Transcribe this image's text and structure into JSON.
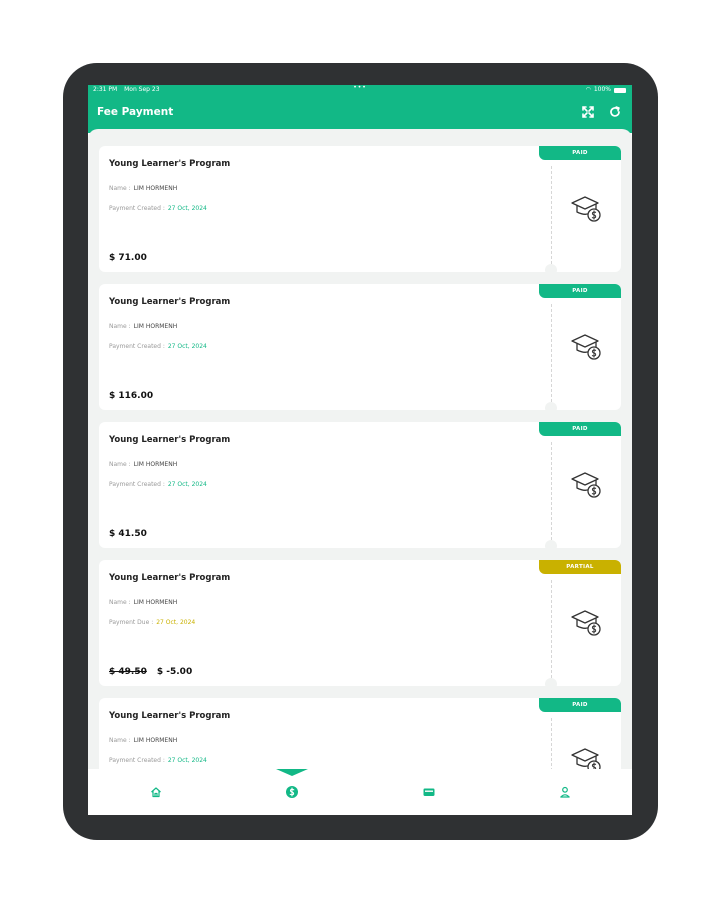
{
  "status_bar": {
    "time": "2:31 PM",
    "date": "Mon Sep 23",
    "dots": "•••",
    "battery": "100%"
  },
  "header": {
    "title": "Fee Payment"
  },
  "cards": [
    {
      "title": "Young Learner's Program",
      "name_label": "Name :",
      "name_value": "LIM HORMENH",
      "date_label": "Payment Created :",
      "date_value": "27 Oct, 2024",
      "amount": "$ 71.00",
      "original_amount": "",
      "status": "PAID"
    },
    {
      "title": "Young Learner's Program",
      "name_label": "Name :",
      "name_value": "LIM HORMENH",
      "date_label": "Payment Created :",
      "date_value": "27 Oct, 2024",
      "amount": "$ 116.00",
      "original_amount": "",
      "status": "PAID"
    },
    {
      "title": "Young Learner's Program",
      "name_label": "Name :",
      "name_value": "LIM HORMENH",
      "date_label": "Payment Created :",
      "date_value": "27 Oct, 2024",
      "amount": "$ 41.50",
      "original_amount": "",
      "status": "PAID"
    },
    {
      "title": "Young Learner's Program",
      "name_label": "Name :",
      "name_value": "LIM HORMENH",
      "date_label": "Payment Due :",
      "date_value": "27 Oct, 2024",
      "amount": "$ -5.00",
      "original_amount": "$ 49.50",
      "status": "PARTIAL"
    },
    {
      "title": "Young Learner's Program",
      "name_label": "Name :",
      "name_value": "LIM HORMENH",
      "date_label": "Payment Created :",
      "date_value": "27 Oct, 2024",
      "amount": "",
      "original_amount": "",
      "status": "PAID"
    }
  ],
  "bottom_nav": {
    "items": [
      "home-icon",
      "dollar-coin-icon",
      "card-icon",
      "profile-icon"
    ],
    "active": "dollar-coin-icon"
  },
  "colors": {
    "brand": "#12b886",
    "partial": "#c9b100",
    "device": "#2f3133"
  }
}
